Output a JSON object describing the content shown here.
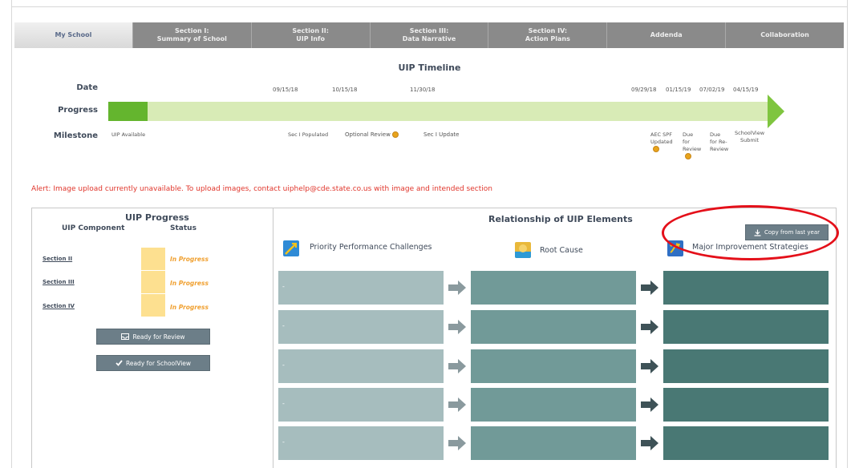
{
  "tabs": [
    {
      "line1": "My School",
      "line2": ""
    },
    {
      "line1": "Section I:",
      "line2": "Summary of School"
    },
    {
      "line1": "Section II:",
      "line2": "UIP Info"
    },
    {
      "line1": "Section III:",
      "line2": "Data Narrative"
    },
    {
      "line1": "Section IV:",
      "line2": "Action Plans"
    },
    {
      "line1": "Addenda",
      "line2": ""
    },
    {
      "line1": "Collaboration",
      "line2": ""
    }
  ],
  "timeline": {
    "title": "UIP Timeline",
    "row_labels": {
      "date": "Date",
      "progress": "Progress",
      "milestone": "Milestone"
    },
    "dates": [
      "09/15/18",
      "10/15/18",
      "11/30/18",
      "09/29/18",
      "01/15/19",
      "07/02/19",
      "04/15/19"
    ],
    "progress_fraction": 0.06,
    "milestones": {
      "uip_available": "UIP Available",
      "sec1_populated": "Sec I Populated",
      "optional_review": "Optional Review",
      "sec1_update": "Sec I Update",
      "aec_spf_1": "AEC SPF",
      "aec_spf_2": "Updated",
      "due_review_1": "Due",
      "due_review_2": "for",
      "due_review_3": "Review",
      "due_rereview_1": "Due",
      "due_rereview_2": "for Re-",
      "due_rereview_3": "Review",
      "schoolview_1": "SchoolView",
      "schoolview_2": "Submit"
    }
  },
  "alert": "Alert: Image upload currently unavailable. To upload images, contact uiphelp@cde.state.co.us with image and intended section",
  "progress_panel": {
    "title": "UIP Progress",
    "col_component": "UIP Component",
    "col_status": "Status",
    "rows": [
      {
        "label": "Section II",
        "status": "In Progress"
      },
      {
        "label": "Section III",
        "status": "In Progress"
      },
      {
        "label": "Section IV",
        "status": "In Progress"
      }
    ],
    "ready_review": "Ready for Review",
    "ready_schoolview": "Ready for SchoolView"
  },
  "relationship_panel": {
    "title": "Relationship of UIP Elements",
    "copy_button": "Copy from last year",
    "columns": [
      "Priority Performance Challenges",
      "Root Cause",
      "Major Improvement Strategies"
    ],
    "row_marker": "-"
  },
  "colors": {
    "alert": "#e0352b",
    "status": "#f0a030",
    "progress_fill": "#64b52e",
    "progress_track": "#d8ebb6",
    "annotation_circle": "#e4101a"
  }
}
